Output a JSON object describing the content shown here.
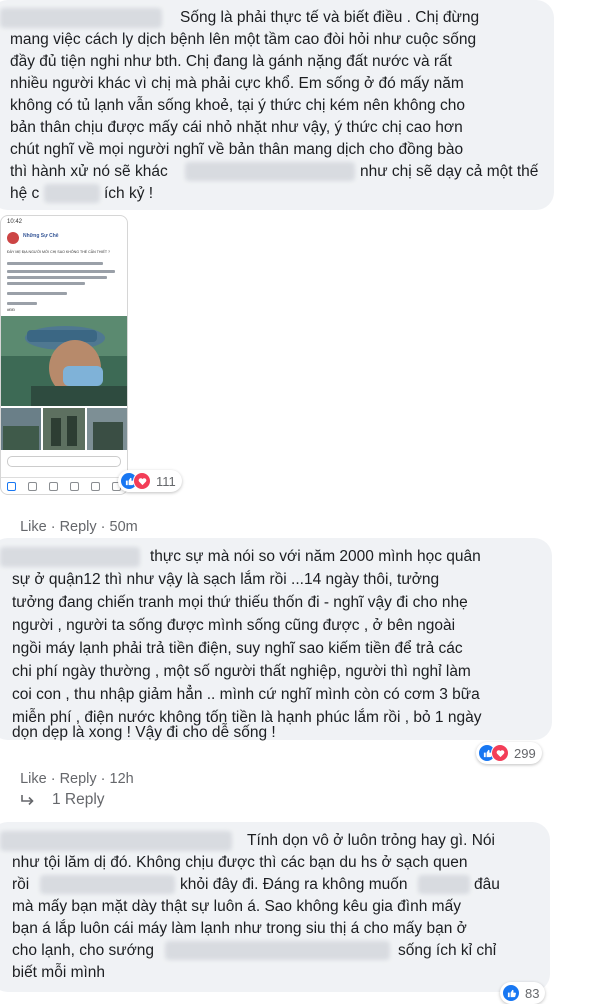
{
  "comments": [
    {
      "lines": [
        "Sống là phải thực tế và biết điều . Chị đừng",
        "mang việc cách ly dịch bệnh lên một tầm cao đòi hỏi như cuộc sống",
        "đầy đủ tiện nghi như bth. Chị đang là gánh nặng đất nước và rất",
        "nhiều người khác vì chị mà phải cực khổ. Em sống ở đó mấy năm",
        "không có tủ lạnh vẫn sống khoẻ, tại ý thức chị kém nên không cho",
        "bản thân chịu được mấy cái nhỏ nhặt như vậy, ý thức chị cao hơn",
        "chút nghĩ về mọi người nghĩ về bản thân mang dịch cho đồng bào",
        "thì hành xử nó sẽ khác",
        "như chị sẽ dạy cả một thế",
        "hệ c",
        "ích kỷ !"
      ],
      "reactions": "111",
      "like": "Like",
      "reply": "Reply",
      "time": "50m"
    },
    {
      "lines": [
        "thực sự mà nói so với năm 2000 mình học quân",
        "sự ở quận12 thì như vậy là sạch lắm rồi ...14 ngày thôi, tưởng",
        "tưởng đang chiến tranh mọi thứ thiếu thốn đi - nghĩ vậy đi cho nhẹ",
        "người , người ta sống được mình sống cũng được , ở bên ngoài",
        "ngồi máy lạnh phải trả tiền điện, suy nghĩ sao kiếm tiền để trả các",
        "chi phí ngày thường , một số người thất nghiệp, người thì nghỉ làm",
        "coi con , thu nhập giảm hẳn .. mình cứ nghĩ mình còn có cơm 3 bữa",
        "miễn phí , điện nước không tốn tiền là hạnh phúc lắm rồi , bỏ 1 ngày",
        "dọn dẹp là xong ! Vậy đi cho dễ sống !"
      ],
      "reactions": "299",
      "like": "Like",
      "reply": "Reply",
      "time": "12h",
      "replies_label": "1 Reply"
    },
    {
      "lines": [
        "Tính dọn vô ở luôn trỏng hay gì. Nói",
        "như tội lăm dị đó. Không chịu được thì các bạn du hs ở sạch quen",
        "rồi",
        "khỏi đây đi. Đáng ra không muốn",
        "đâu",
        "mà mấy bạn mặt dày thật sự luôn á. Sao không kêu gia đình mấy",
        "bạn á lắp luôn cái máy làm lạnh như trong siu thị á cho mấy bạn ở",
        "cho lạnh, cho sướng",
        "sống ích kỉ chỉ",
        "biết mỗi mình"
      ],
      "reactions": "83"
    }
  ],
  "screenshot": {
    "status_time": "10:42",
    "page_name": "Những Sự Chê",
    "post_title": "ĐÂY MẸ ĐỊA NGƯỜI MỚI CHỊ SAO KHÔNG THỂ CẦN THIẾT ?",
    "author_tag": "#ĐĐ"
  },
  "colors": {
    "bubble": "#f0f2f5",
    "like": "#1877f2",
    "love": "#f33e58",
    "meta": "#65676b"
  },
  "icons": {
    "like": "thumbs-up-icon",
    "love": "heart-icon",
    "reply_arrow": "reply-arrow-icon"
  }
}
